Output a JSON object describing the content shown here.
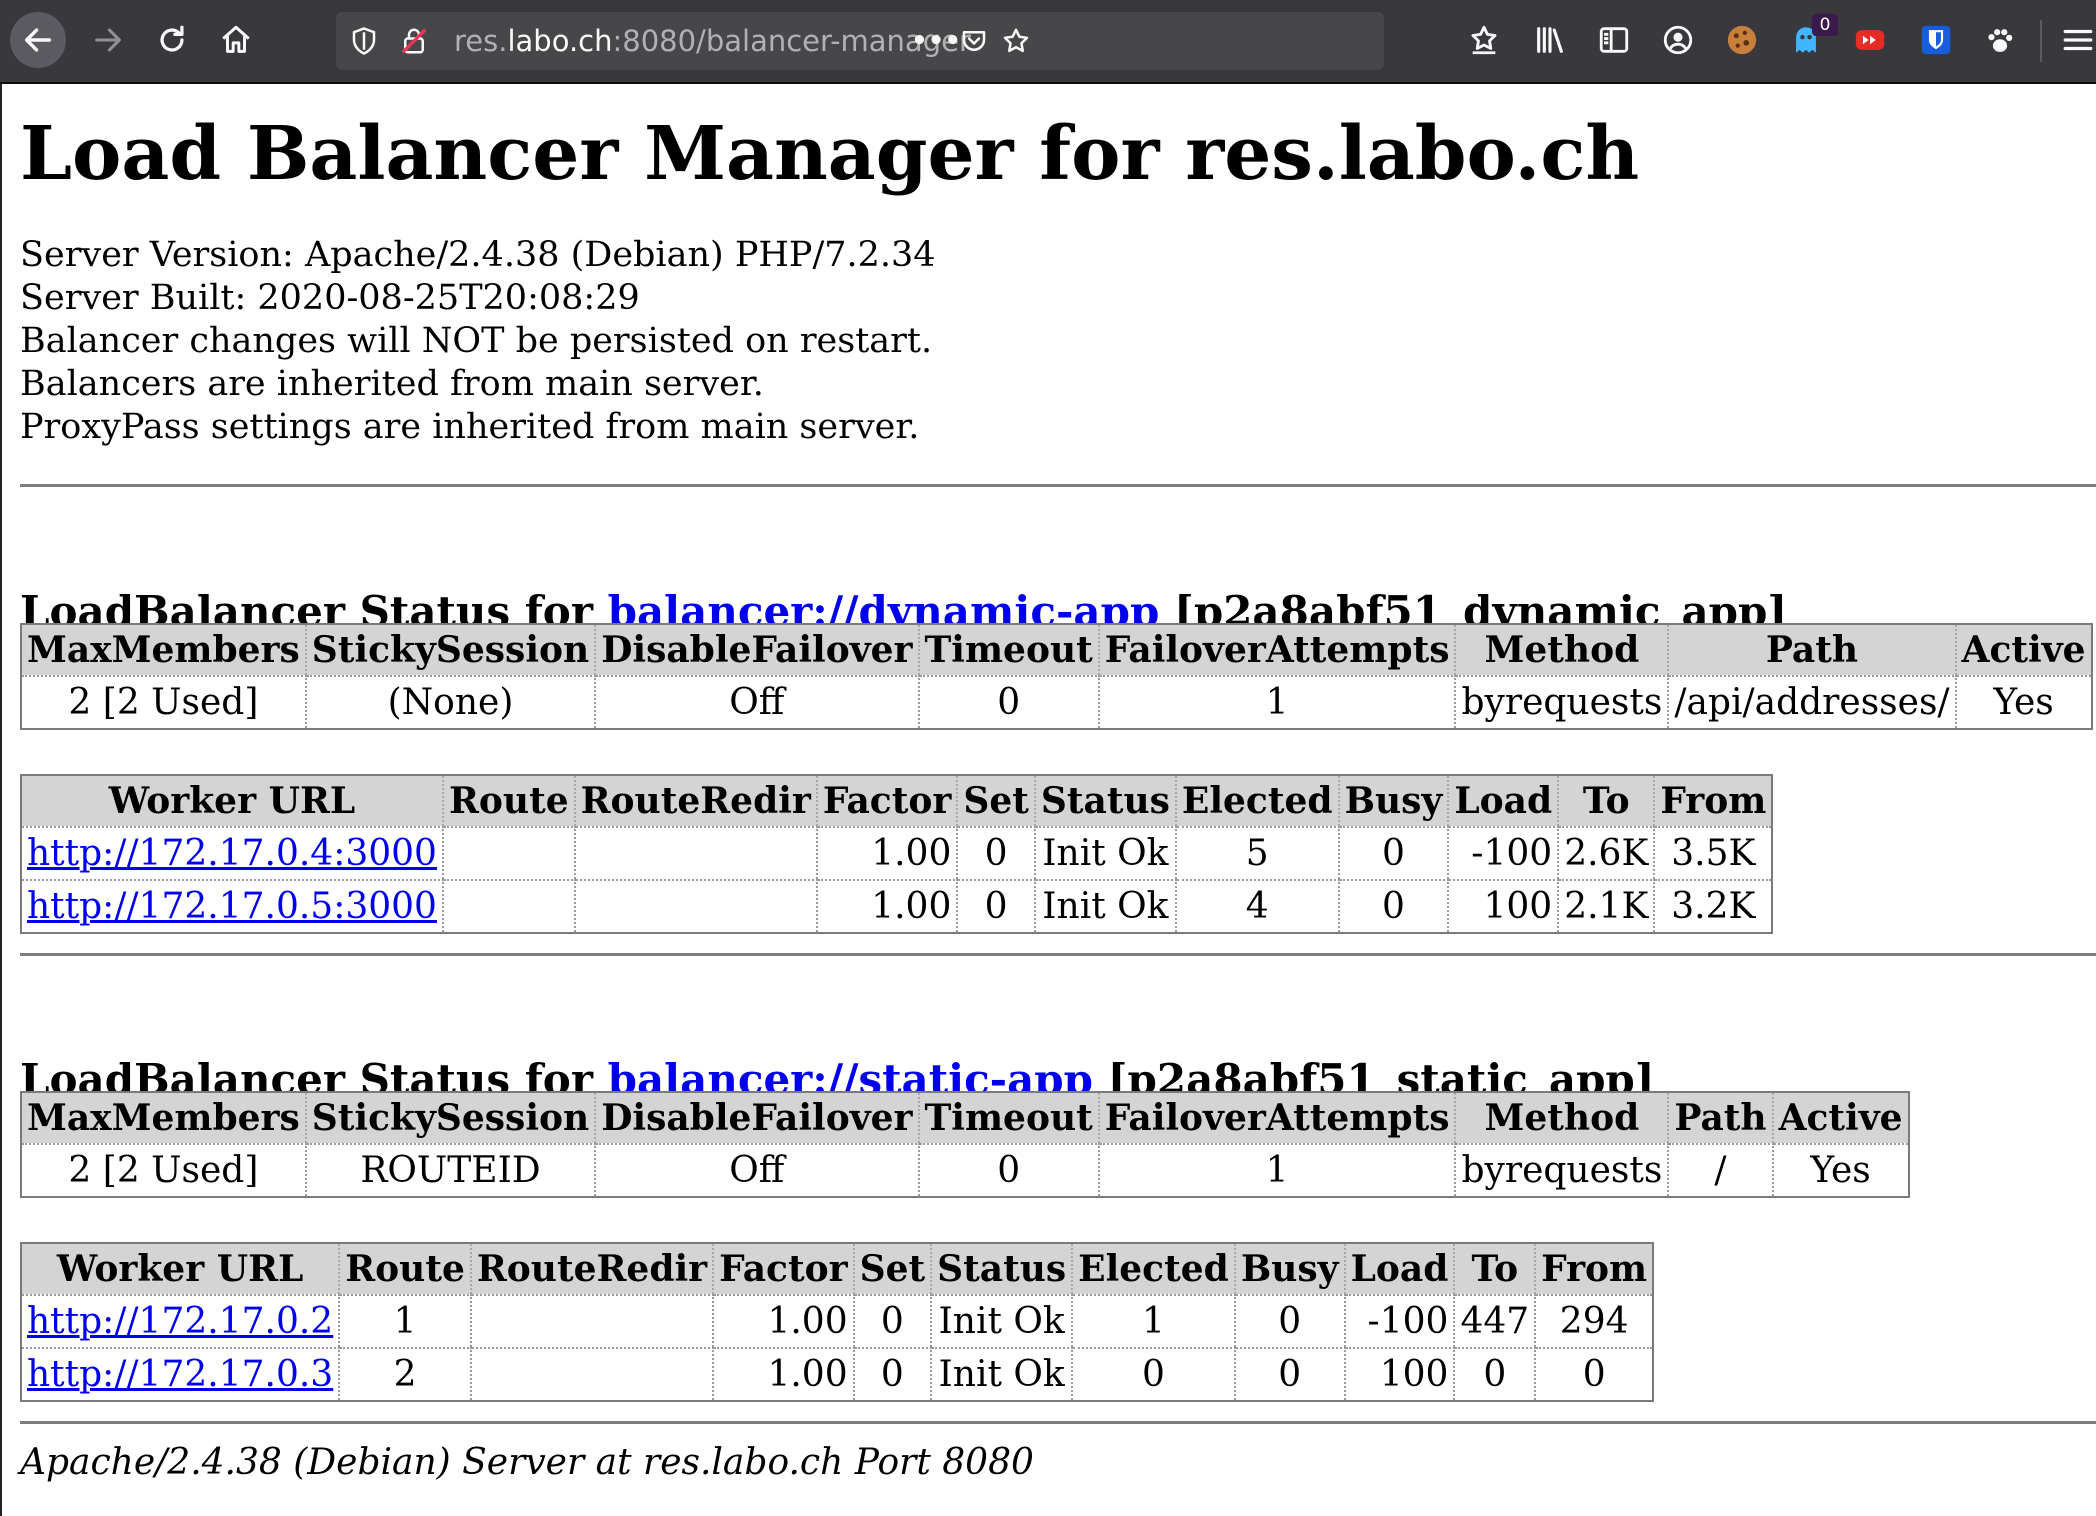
{
  "browser": {
    "url_prefix": "res.",
    "url_host": "labo.ch",
    "url_rest": ":8080/balancer-manager",
    "page_actions_label": "•••",
    "extension_badge": "0",
    "colors": {
      "toolbar": "#38383d",
      "urlbar": "#474749",
      "link": "#0000ee"
    }
  },
  "page": {
    "title": "Load Balancer Manager for res.labo.ch",
    "info_lines": [
      "Server Version: Apache/2.4.38 (Debian) PHP/7.2.34",
      "Server Built: 2020-08-25T20:08:29",
      "Balancer changes will NOT be persisted on restart.",
      "Balancers are inherited from main server.",
      "ProxyPass settings are inherited from main server."
    ],
    "footer": "Apache/2.4.38 (Debian) Server at res.labo.ch Port 8080"
  },
  "balancer_headers": [
    "MaxMembers",
    "StickySession",
    "DisableFailover",
    "Timeout",
    "FailoverAttempts",
    "Method",
    "Path",
    "Active"
  ],
  "worker_headers": [
    "Worker URL",
    "Route",
    "RouteRedir",
    "Factor",
    "Set",
    "Status",
    "Elected",
    "Busy",
    "Load",
    "To",
    "From"
  ],
  "balancers": [
    {
      "heading_prefix": "LoadBalancer Status for ",
      "link": "balancer://dynamic-app",
      "heading_suffix": " [p2a8abf51_dynamic_app]",
      "settings": [
        "2 [2 Used]",
        "(None)",
        "Off",
        "0",
        "1",
        "byrequests",
        "/api/addresses/",
        "Yes"
      ],
      "workers": [
        [
          "http://172.17.0.4:3000",
          "",
          "",
          "1.00",
          "0",
          "Init Ok",
          "5",
          "0",
          "-100",
          "2.6K",
          "3.5K"
        ],
        [
          "http://172.17.0.5:3000",
          "",
          "",
          "1.00",
          "0",
          "Init Ok",
          "4",
          "0",
          "100",
          "2.1K",
          "3.2K"
        ]
      ]
    },
    {
      "heading_prefix": "LoadBalancer Status for ",
      "link": "balancer://static-app",
      "heading_suffix": " [p2a8abf51_static_app]",
      "settings": [
        "2 [2 Used]",
        "ROUTEID",
        "Off",
        "0",
        "1",
        "byrequests",
        "/",
        "Yes"
      ],
      "workers": [
        [
          "http://172.17.0.2",
          "1",
          "",
          "1.00",
          "0",
          "Init Ok",
          "1",
          "0",
          "-100",
          "447",
          "294"
        ],
        [
          "http://172.17.0.3",
          "2",
          "",
          "1.00",
          "0",
          "Init Ok",
          "0",
          "0",
          "100",
          "0",
          "0"
        ]
      ]
    }
  ]
}
